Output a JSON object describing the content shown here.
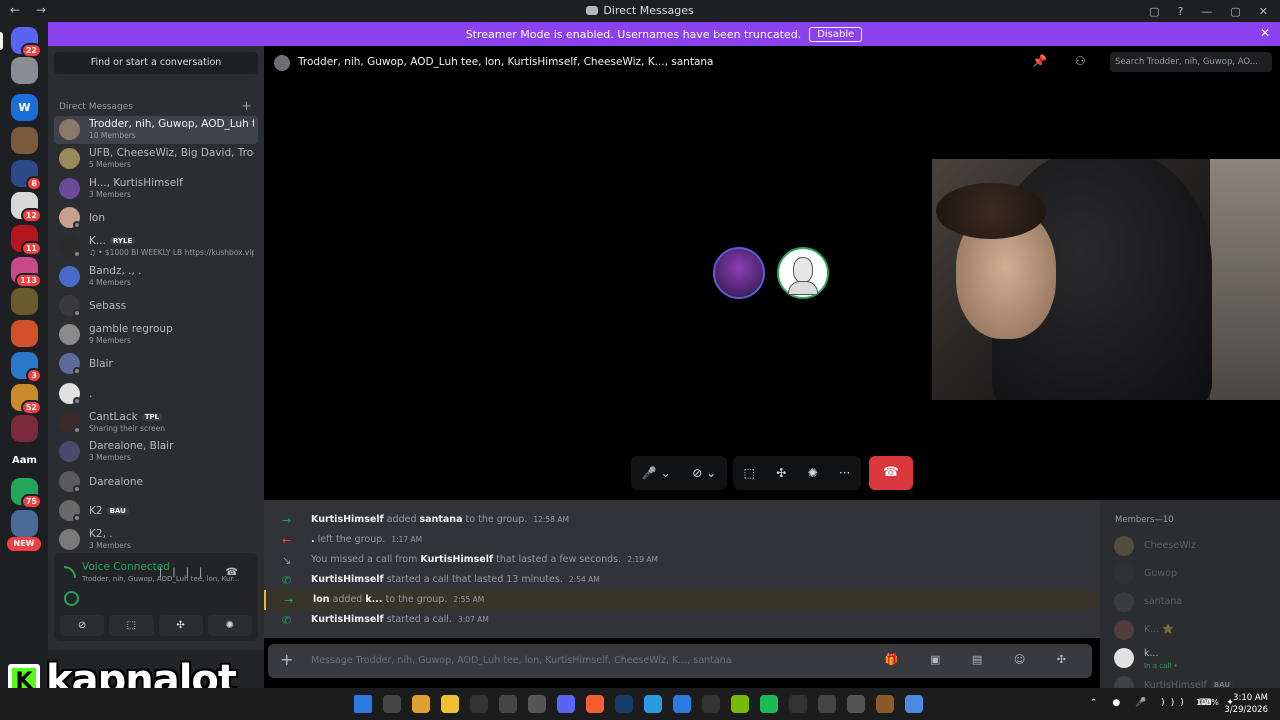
{
  "window": {
    "title": "Direct Messages",
    "nav": "← →",
    "controls": [
      "▢",
      "?",
      "—",
      "▢",
      "✕"
    ]
  },
  "banner": {
    "text": "Streamer Mode is enabled. Usernames have been truncated.",
    "button": "Disable"
  },
  "servers": [
    {
      "label": "",
      "badge": "22",
      "color": "#5865f2"
    },
    {
      "label": "",
      "badge": "",
      "color": "#8a8d93"
    },
    {
      "label": "W",
      "badge": "",
      "color": "#1a6fd8"
    },
    {
      "label": "",
      "badge": "",
      "color": "#7a5a3a"
    },
    {
      "label": "",
      "badge": "8",
      "color": "#2c4a8a"
    },
    {
      "label": "",
      "badge": "12",
      "color": "#d8d8d8"
    },
    {
      "label": "",
      "badge": "11",
      "color": "#b3171d"
    },
    {
      "label": "",
      "badge": "113",
      "color": "#c94a8b"
    },
    {
      "label": "",
      "badge": "",
      "color": "#6b5a2a"
    },
    {
      "label": "",
      "badge": "",
      "color": "#d4502b"
    },
    {
      "label": "",
      "badge": "3",
      "color": "#2a7ac9"
    },
    {
      "label": "",
      "badge": "52",
      "color": "#c98a2a"
    },
    {
      "label": "",
      "badge": "",
      "color": "#7a2a3a"
    },
    {
      "label": "Aam",
      "badge": "",
      "color": "#1e1f22"
    },
    {
      "label": "",
      "badge": "75",
      "color": "#23a55a"
    },
    {
      "label": "",
      "badge": "",
      "color": "#4a6a9a"
    },
    {
      "label": "NEW",
      "badge": "",
      "color": "#f23f42"
    }
  ],
  "sidebar": {
    "find": "Find or start a conversation",
    "header": "Direct Messages",
    "plus": "+",
    "dms": [
      {
        "name": "Trodder, nih, Guwop, AOD_Luh tee...",
        "sub": "10 Members",
        "active": true,
        "color": "#8a7a6a"
      },
      {
        "name": "UFB, CheeseWiz, Big David, Trodder",
        "sub": "5 Members",
        "active": false,
        "color": "#9a8a5a"
      },
      {
        "name": "H..., KurtisHimself",
        "sub": "3 Members",
        "active": false,
        "color": "#6a4a9a"
      },
      {
        "name": "lon",
        "sub": "",
        "active": false,
        "color": "#c9a090"
      },
      {
        "name": "K...",
        "tag": "RYLE",
        "sub": "♫ • $1000 BI WEEKLY LB https://kushbox.vip/",
        "active": false,
        "color": "#2a2a2a"
      },
      {
        "name": "Bandz, ., .",
        "sub": "4 Members",
        "active": false,
        "color": "#4a6ac9"
      },
      {
        "name": "Sebass",
        "sub": "",
        "active": false,
        "color": "#3a3a3a"
      },
      {
        "name": "gamble regroup",
        "sub": "9 Members",
        "active": false,
        "color": "#8a8a8a"
      },
      {
        "name": "Blair",
        "sub": "",
        "active": false,
        "color": "#5a6a9a"
      },
      {
        "name": ".",
        "sub": "",
        "active": false,
        "color": "#e0e0e0"
      },
      {
        "name": "CantLack",
        "tag": "TPL",
        "sub": "Sharing their screen",
        "active": false,
        "color": "#3a2a2a"
      },
      {
        "name": "Darealone, Blair",
        "sub": "3 Members",
        "active": false,
        "color": "#4a4a6a"
      },
      {
        "name": "Darealone",
        "sub": "",
        "active": false,
        "color": "#5a5a5a"
      },
      {
        "name": "K2",
        "tag": "BAU",
        "sub": "",
        "active": false,
        "color": "#6a6a6a"
      },
      {
        "name": "K2, .",
        "sub": "3 Members",
        "active": false,
        "color": "#7a7a7a"
      }
    ]
  },
  "voice": {
    "status": "Voice Connected",
    "channel": "Trodder, nih, Guwop, AOD_Luh tee, lon, Kur...",
    "icons": "|||| ☎",
    "buttons": [
      "⊘",
      "⬚",
      "✣",
      "✺"
    ]
  },
  "streamer_logo": {
    "letter": "K",
    "word": "kapnalot"
  },
  "chat": {
    "title": "Trodder, nih, Guwop, AOD_Luh tee, lon, KurtisHimself, CheeseWiz, K..., santana",
    "header_icons": "📌 ⚇ 👥",
    "search_placeholder": "Search Trodder, nih, Guwop, AO...",
    "messages": [
      {
        "arrow": "→",
        "color": "#23a55a",
        "user": "KurtisHimself",
        "text": "added",
        "target": "santana",
        "rest": "to the group.",
        "time": "12:58 AM",
        "highlight": false
      },
      {
        "arrow": "←",
        "color": "#f23f42",
        "user": ".",
        "text": "left the group.",
        "target": "",
        "rest": "",
        "time": "1:17 AM",
        "highlight": false
      },
      {
        "arrow": "↘",
        "color": "#949ba4",
        "user": "",
        "text": "You missed a call from",
        "target": "KurtisHimself",
        "rest": "that lasted a few seconds.",
        "time": "2:19 AM",
        "highlight": false
      },
      {
        "arrow": "✆",
        "color": "#23a55a",
        "user": "KurtisHimself",
        "text": "started a call that lasted 13 minutes.",
        "target": "",
        "rest": "",
        "time": "2:54 AM",
        "highlight": false
      },
      {
        "arrow": "→",
        "color": "#23a55a",
        "user": "lon",
        "text": "added",
        "target": "k...",
        "rest": "to the group.",
        "time": "2:55 AM",
        "highlight": true
      },
      {
        "arrow": "✆",
        "color": "#23a55a",
        "user": "KurtisHimself",
        "text": "started a call.",
        "target": "",
        "rest": "",
        "time": "3:07 AM",
        "highlight": false
      }
    ],
    "composer_placeholder": "Message Trodder, nih, Guwop, AOD_Luh tee, lon, KurtisHimself, CheeseWiz, K..., santana",
    "composer_plus": "+",
    "composer_icons": "🎁 ▣ ▤ ☺ ✣"
  },
  "call_controls": {
    "mic": "🎤 ⌄",
    "camera": "⊘ ⌄",
    "share": "⬚",
    "activities": "✣",
    "soundboard": "✺",
    "more": "···",
    "end": "☎"
  },
  "members": {
    "header": "Members—10",
    "list": [
      {
        "name": "CheeseWiz",
        "sub": "",
        "online": false,
        "color": "#9a8a5a"
      },
      {
        "name": "Guwop",
        "sub": "",
        "online": false,
        "color": "#3a3a3a"
      },
      {
        "name": "santana",
        "sub": "",
        "online": false,
        "color": "#5a5a5a"
      },
      {
        "name": "K... ⭐",
        "sub": "",
        "online": false,
        "color": "#9a5a5a"
      },
      {
        "name": "k...",
        "sub": "In a call •",
        "online": true,
        "color": "#e0e0e0"
      },
      {
        "name": "KurtisHimself",
        "tag": "BAU",
        "sub": "",
        "online": false,
        "color": "#6a6a6a"
      }
    ]
  },
  "taskbar": {
    "apps": [
      "#2a7ae0",
      "#444",
      "#e0a030",
      "#f0c030",
      "#333",
      "#444",
      "#555",
      "#5865f2",
      "#f06030",
      "#1a3a6a",
      "#2a9ae0",
      "#2a7ae0",
      "#333",
      "#76b900",
      "#1db954",
      "#333",
      "#444",
      "#555",
      "#8a5a2a",
      "#4a8ae0"
    ],
    "tray_icons": "⌃ ● 🎤 ))) ⌨ ✦",
    "battery": "100%",
    "time": "3:10 AM",
    "date": "3/29/2026"
  }
}
